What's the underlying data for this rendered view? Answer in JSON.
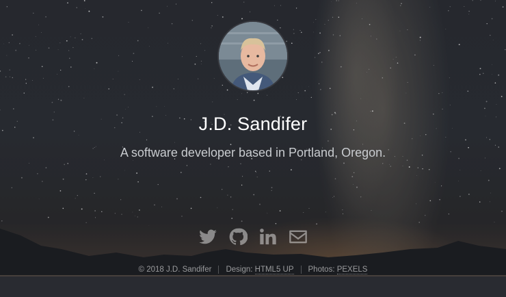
{
  "profile": {
    "name": "J.D. Sandifer",
    "tagline": "A software developer based in Portland, Oregon."
  },
  "social": [
    {
      "icon": "twitter-icon"
    },
    {
      "icon": "github-icon"
    },
    {
      "icon": "linkedin-icon"
    },
    {
      "icon": "envelope-icon"
    }
  ],
  "footer": {
    "copyright": "© 2018 J.D. Sandifer",
    "design_prefix": "Design: ",
    "design_link": "HTML5 UP",
    "photos_prefix": "Photos: ",
    "photos_link": "PEXELS"
  },
  "colors": {
    "background": "#2a2d33",
    "text": "#ffffff",
    "tagline": "#c9ccd0",
    "icon": "rgba(255,255,255,0.45)"
  }
}
